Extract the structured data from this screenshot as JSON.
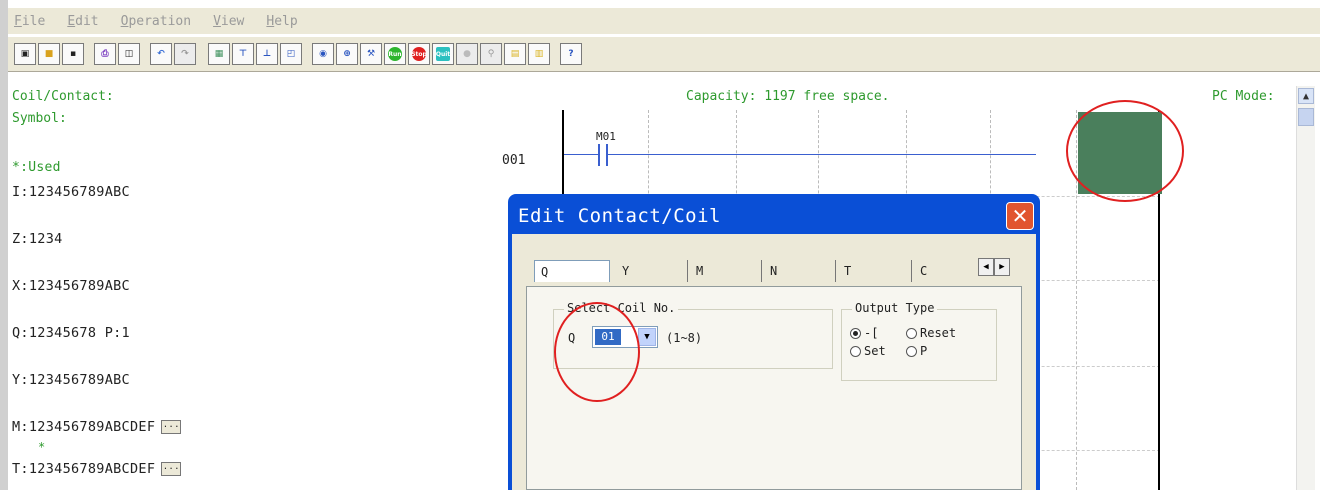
{
  "menu": [
    "File",
    "Edit",
    "Operation",
    "View",
    "Help"
  ],
  "toolbar": {
    "buttons": [
      {
        "icon": "new-icon",
        "label": ""
      },
      {
        "icon": "open-icon",
        "label": ""
      },
      {
        "icon": "save-icon",
        "label": ""
      },
      {
        "icon": "print-icon",
        "label": ""
      },
      {
        "icon": "preview-icon",
        "label": ""
      },
      {
        "icon": "undo-icon",
        "label": ""
      },
      {
        "icon": "redo-icon",
        "label": ""
      },
      {
        "icon": "ladder-icon",
        "label": ""
      },
      {
        "icon": "insert-line-icon",
        "label": ""
      },
      {
        "icon": "delete-line-icon",
        "label": ""
      },
      {
        "icon": "symbol-icon",
        "label": ""
      },
      {
        "icon": "connect-icon",
        "label": ""
      },
      {
        "icon": "write-icon",
        "label": ""
      },
      {
        "icon": "tool-icon",
        "label": ""
      },
      {
        "icon": "run-icon",
        "label": "Run",
        "color": "#2db52d"
      },
      {
        "icon": "stop-icon",
        "label": "Stop",
        "color": "#e02020"
      },
      {
        "icon": "quit-icon",
        "label": "Quit",
        "color": "#2cc0c0"
      },
      {
        "icon": "record-icon",
        "label": ""
      },
      {
        "icon": "monitor-icon",
        "label": ""
      },
      {
        "icon": "page-icon",
        "label": ""
      },
      {
        "icon": "page2-icon",
        "label": ""
      },
      {
        "icon": "help-icon",
        "label": ""
      }
    ]
  },
  "status": {
    "coil_contact": "Coil/Contact:",
    "symbol": "Symbol:",
    "capacity": "Capacity: 1197 free space.",
    "mode": "PC Mode:"
  },
  "memory": {
    "used_label": "*:Used",
    "lines": [
      "I:123456789ABC",
      "Z:1234",
      "X:123456789ABC",
      "Q:12345678 P:1",
      "Y:123456789ABC",
      "M:123456789ABCDEF",
      "T:123456789ABCDEF"
    ],
    "more_label": "...",
    "star": "*"
  },
  "ladder": {
    "line_no": "001",
    "contact": "M01",
    "coil_color": "#4a7f5c"
  },
  "dialog": {
    "title": "Edit Contact/Coil",
    "close": "✕",
    "tabs": [
      "Q",
      "Y",
      "M",
      "N",
      "T",
      "C"
    ],
    "select_group": "Select Coil No.",
    "prefix": "Q",
    "selected": "01",
    "range": "(1~8)",
    "output_group": "Output Type",
    "options": [
      "-[",
      "Reset",
      "Set",
      "P"
    ]
  },
  "colors": {
    "highlight": "#e02020"
  }
}
